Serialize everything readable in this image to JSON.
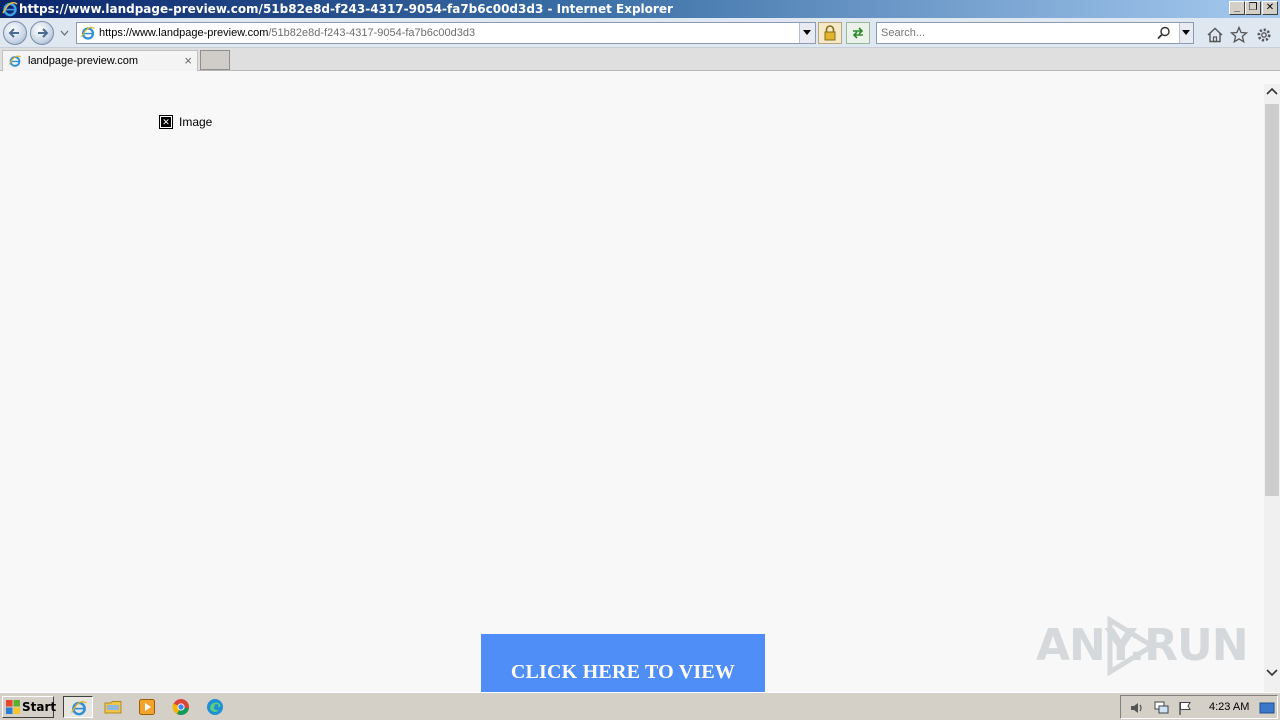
{
  "window": {
    "title": "https://www.landpage-preview.com/51b82e8d-f243-4317-9054-fa7b6c00d3d3 - Internet Explorer",
    "controls": {
      "minimize": "_",
      "restore": "❐",
      "close": "✕"
    }
  },
  "navbar": {
    "url_scheme": "https://www.",
    "url_domain": "landpage-preview.com",
    "url_path": "/51b82e8d-f243-4317-9054-fa7b6c00d3d3",
    "search_placeholder": "Search..."
  },
  "tabs": [
    {
      "label": "landpage-preview.com",
      "close": "×"
    }
  ],
  "content": {
    "broken_image_alt": "Image",
    "cta_label": "CLICK HERE TO VIEW",
    "watermark": "ANY.RUN"
  },
  "taskbar": {
    "start_label": "Start",
    "clock": "4:23 AM",
    "apps": [
      "internet-explorer",
      "file-explorer",
      "media-player",
      "chrome",
      "edge"
    ]
  },
  "colors": {
    "cta_bg": "#4f8ef7",
    "title_bar": "#0a246a",
    "page_bg": "#f8f8f8"
  }
}
